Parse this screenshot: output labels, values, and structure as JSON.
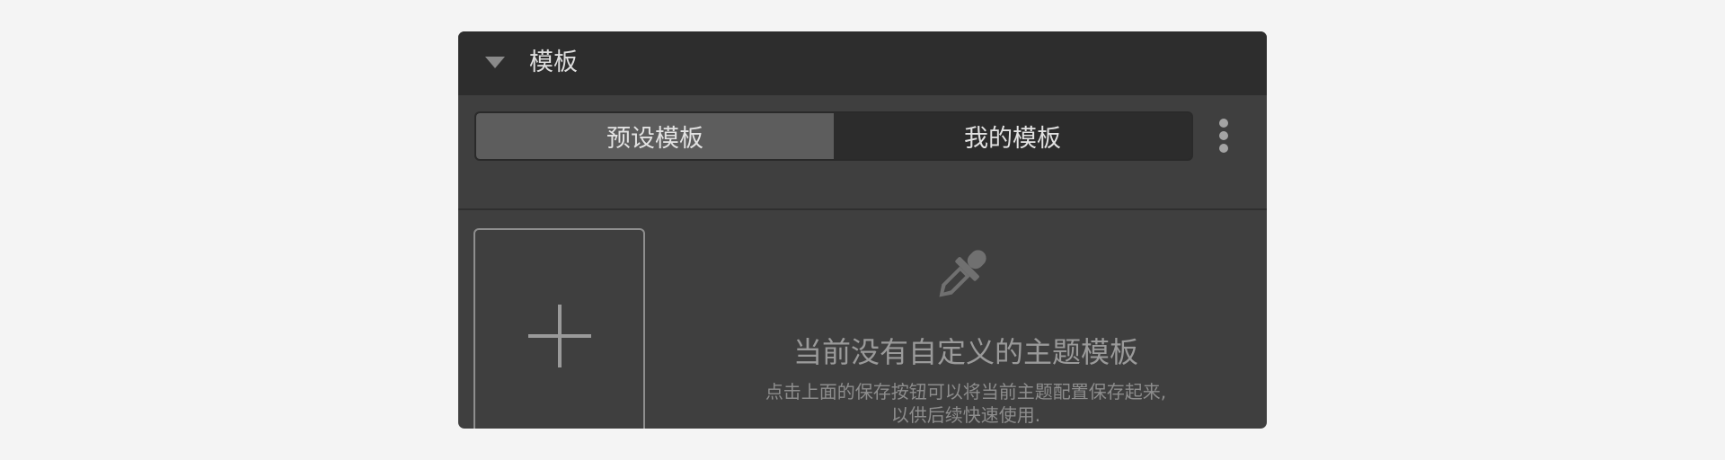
{
  "panel": {
    "title": "模板",
    "collapse_icon": "caret-down-icon"
  },
  "tabs": [
    {
      "label": "预设模板",
      "active": true
    },
    {
      "label": "我的模板",
      "active": false
    }
  ],
  "more_icon": "vertical-ellipsis-icon",
  "add_card": {
    "icon": "plus-icon"
  },
  "empty_state": {
    "icon": "eyedropper-icon",
    "title": "当前没有自定义的主题模板",
    "description_line1": "点击上面的保存按钮可以将当前主题配置保存起来,",
    "description_line2": "以供后续快速使用."
  },
  "colors": {
    "page_background": "#f4f4f4",
    "panel_background": "#3f3f3f",
    "header_background": "#2d2d2d",
    "active_tab": "#5d5d5d",
    "inactive_tab": "#2c2c2c",
    "muted_text": "#9a9a9a"
  }
}
